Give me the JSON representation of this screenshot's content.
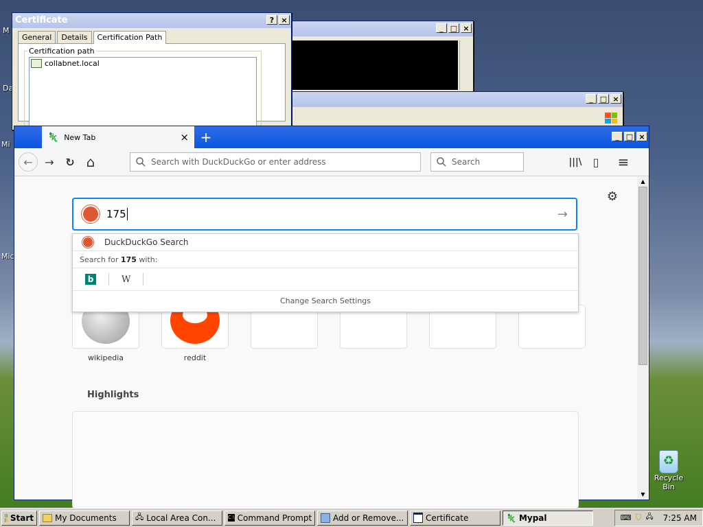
{
  "desktop": {
    "edge_labels": [
      "M",
      "Da",
      "Mi",
      "Mic"
    ],
    "recycle_bin": "Recycle Bin"
  },
  "certificate": {
    "title": "Certificate",
    "help": "?",
    "close": "×",
    "tabs": [
      "General",
      "Details",
      "Certification Path"
    ],
    "group_label": "Certification path",
    "path_item": "collabnet.local"
  },
  "cmd_window": {
    "min": "_",
    "max": "□",
    "close": "×"
  },
  "mid_window": {
    "min": "_",
    "max": "□",
    "close": "×"
  },
  "firefox": {
    "tab_title": "New Tab",
    "tab_close": "×",
    "new_tab": "+",
    "win_min": "_",
    "win_max": "□",
    "win_close": "×",
    "back": "←",
    "forward": "→",
    "reload": "↻",
    "home": "⌂",
    "url_placeholder": "Search with DuckDuckGo or enter address",
    "search_placeholder": "Search",
    "library": "|||\\",
    "sidebar": "▯",
    "menu": "≡",
    "settings": "⚙",
    "query": "175",
    "go": "→",
    "dropdown": {
      "engine": "DuckDuckGo Search",
      "search_for_prefix": "Search for ",
      "search_for_term": "175",
      "search_for_suffix": " with:",
      "engines": [
        "b",
        "W"
      ],
      "change_settings": "Change Search Settings"
    },
    "top_sites": [
      "wikipedia",
      "reddit",
      "",
      "",
      "",
      ""
    ],
    "highlights": "Highlights"
  },
  "taskbar": {
    "start": "Start",
    "items": [
      "My Documents",
      "Local Area Con...",
      "Command Prompt",
      "Add or Remove...",
      "Certificate",
      "Mypal"
    ],
    "active_index": 5,
    "time": "7:25 AM"
  },
  "colors": {
    "xp_blue": "#0a57e0",
    "focus_blue": "#0a84ff",
    "ddg_orange": "#de5833",
    "reddit_orange": "#ff4500",
    "bing_teal": "#008373"
  }
}
